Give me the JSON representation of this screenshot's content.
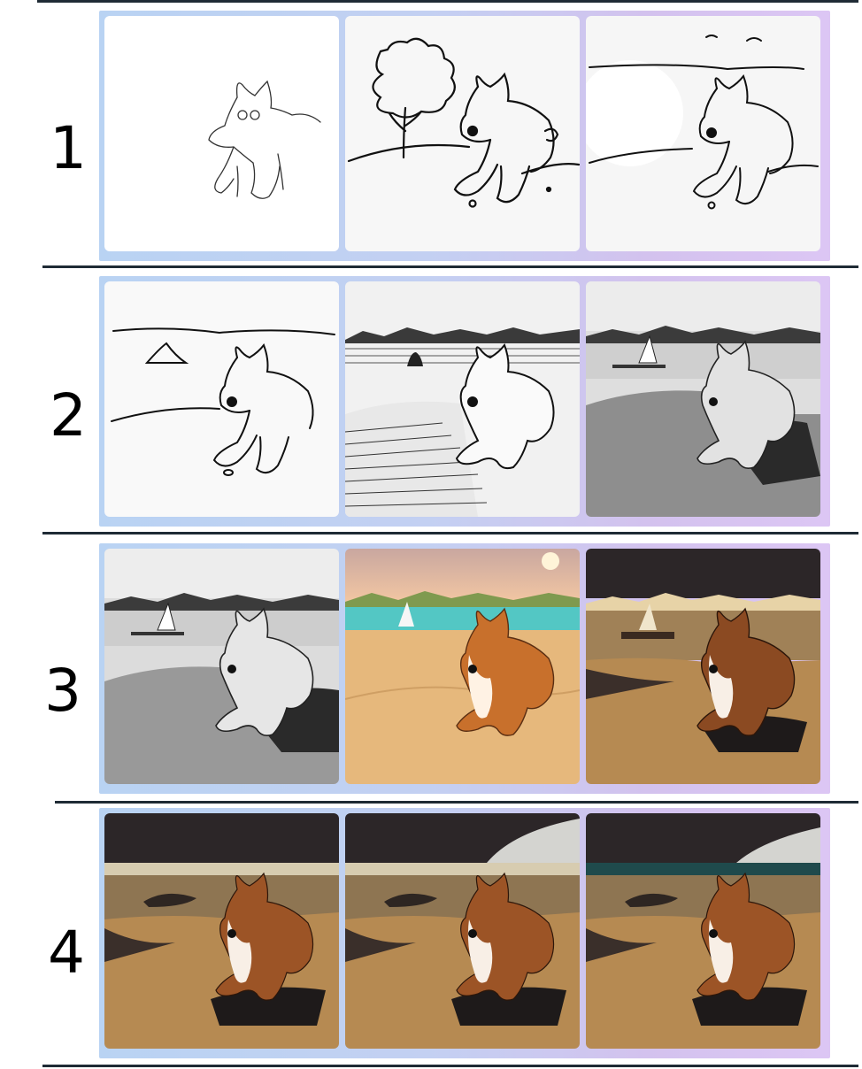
{
  "rows": [
    {
      "label": "1",
      "panels": [
        "sketch-rough",
        "sketch-tree",
        "sketch-horizon"
      ]
    },
    {
      "label": "2",
      "panels": [
        "lineart-beach",
        "lineart-detailed",
        "grayscale-sailboat"
      ]
    },
    {
      "label": "3",
      "panels": [
        "grayscale-sailboat",
        "color-sunset-beach",
        "color-dark-beach"
      ]
    },
    {
      "label": "4",
      "panels": [
        "photo-beach-rock",
        "photo-beach-cliff",
        "photo-beach-cliff-right"
      ]
    }
  ],
  "colors": {
    "rule": "#1f2b35",
    "frame_left": "#b9d3f3",
    "frame_right": "#dcc6f4",
    "corgi_orange": "#c8702c",
    "sand": "#b68a52",
    "dark_sky": "#2c2628"
  }
}
